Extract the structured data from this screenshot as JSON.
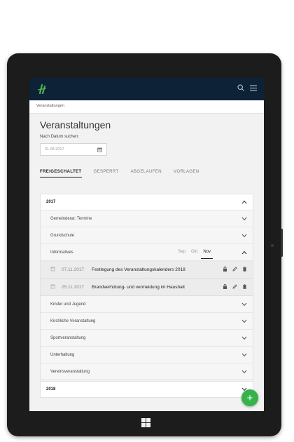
{
  "app": {
    "logo_icon": "app-logo-icon",
    "top_icons": [
      "search-icon",
      "menu-icon"
    ]
  },
  "breadcrumb": "Veranstaltungen",
  "page": {
    "title": "Veranstaltungen",
    "search_label": "Nach Datum suchen:",
    "date_value": "31.08.2017",
    "date_icon": "calendar-icon"
  },
  "tabs": [
    {
      "label": "FREIGESCHALTET",
      "active": true
    },
    {
      "label": "GESPERRT",
      "active": false
    },
    {
      "label": "ABGELAUFEN",
      "active": false
    },
    {
      "label": "VORLAGEN",
      "active": false
    }
  ],
  "years": [
    {
      "label": "2017",
      "expanded": true,
      "categories": [
        "Gemeinderat: Termine",
        "Grundschule",
        "Informatives",
        "Kinder und Jugend",
        "Kirchliche Veranstaltung",
        "Sportveranstaltung",
        "Unterhaltung",
        "Vereinsveranstaltung"
      ]
    },
    {
      "label": "2018",
      "expanded": false
    }
  ],
  "expanded_category": {
    "name": "Informatives",
    "months": [
      "Sep",
      "Okt",
      "Nov"
    ],
    "active_month": "Nov",
    "events": [
      {
        "date": "07.11.2017",
        "title": "Festlegung des Veranstaltungskalenders 2018"
      },
      {
        "date": "25.11.2017",
        "title": "Brandverhütung- und vermeidung im Haushalt"
      }
    ]
  },
  "fab": {
    "label": "+",
    "icon": "plus-icon"
  },
  "colors": {
    "topbar": "#0d2236",
    "accent": "#35b34a",
    "logo": "#4caf50"
  }
}
